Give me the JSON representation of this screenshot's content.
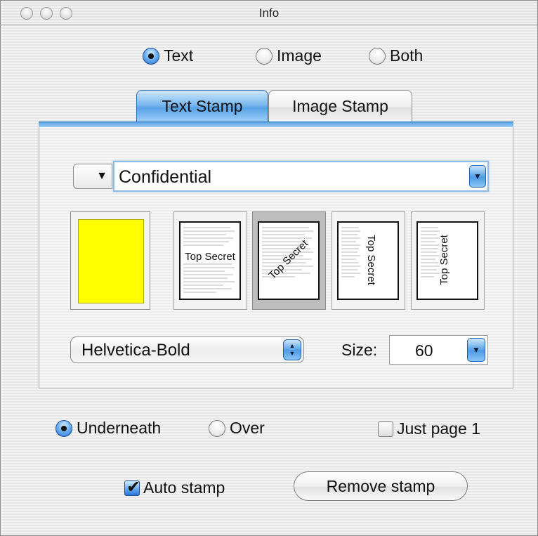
{
  "window": {
    "title": "Info"
  },
  "stamp_type": {
    "options": [
      {
        "label": "Text",
        "selected": true
      },
      {
        "label": "Image",
        "selected": false
      },
      {
        "label": "Both",
        "selected": false
      }
    ]
  },
  "tabs": [
    {
      "label": "Text Stamp",
      "active": true
    },
    {
      "label": "Image Stamp",
      "active": false
    }
  ],
  "stamp_text": {
    "menu_glyph": "▼",
    "value": "Confidential",
    "arrow": "▼"
  },
  "color": {
    "value": "#ffff00"
  },
  "orientations": {
    "stamp_label": "Top Secret",
    "items": [
      {
        "name": "horizontal",
        "selected": false
      },
      {
        "name": "diagonal",
        "selected": true
      },
      {
        "name": "vertical-down",
        "selected": false
      },
      {
        "name": "vertical-up",
        "selected": false
      }
    ]
  },
  "font": {
    "value": "Helvetica-Bold",
    "stepper_up": "▲",
    "stepper_down": "▼"
  },
  "size": {
    "label": "Size:",
    "value": "60",
    "arrow": "▼"
  },
  "layer": {
    "options": [
      {
        "label": "Underneath",
        "selected": true
      },
      {
        "label": "Over",
        "selected": false
      }
    ]
  },
  "just_page_1": {
    "label": "Just page 1",
    "checked": false
  },
  "auto_stamp": {
    "label": "Auto stamp",
    "checked": true
  },
  "remove_button": {
    "label": "Remove stamp"
  }
}
